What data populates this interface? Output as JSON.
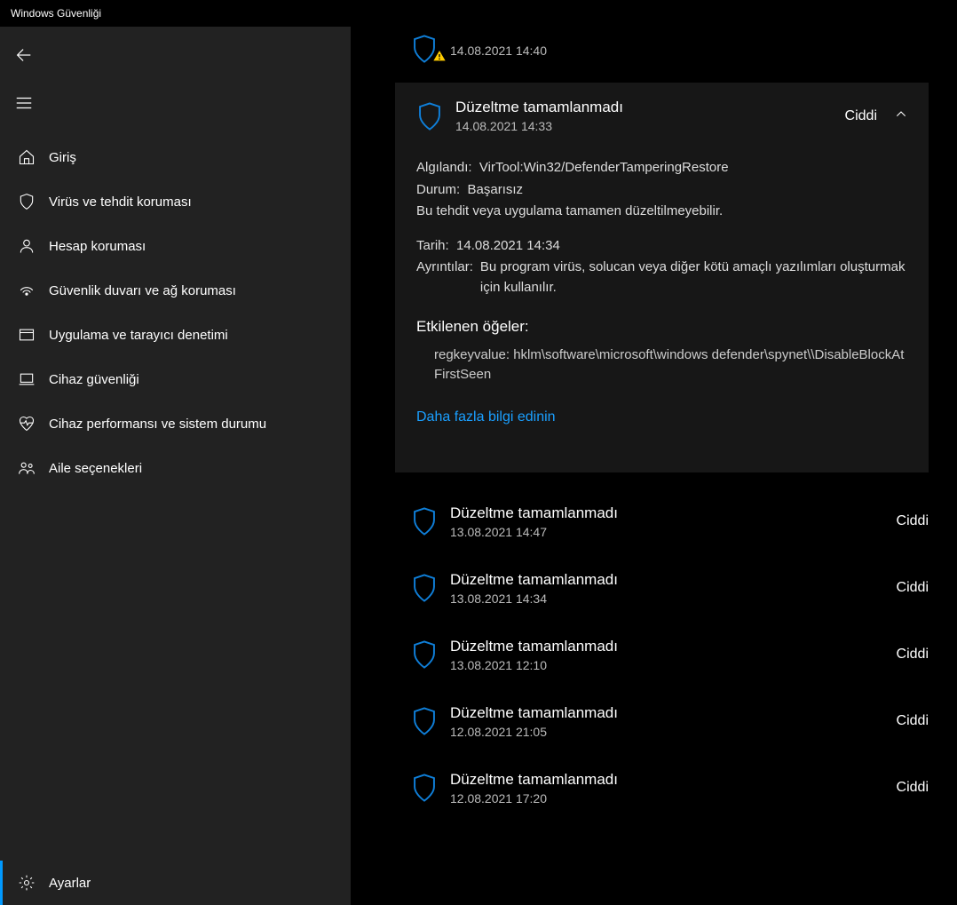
{
  "window": {
    "title": "Windows Güvenliği"
  },
  "sidebar": {
    "items": [
      {
        "label": "Giriş"
      },
      {
        "label": "Virüs ve tehdit koruması"
      },
      {
        "label": "Hesap koruması"
      },
      {
        "label": "Güvenlik duvarı ve ağ koruması"
      },
      {
        "label": "Uygulama ve tarayıcı denetimi"
      },
      {
        "label": "Cihaz güvenliği"
      },
      {
        "label": "Cihaz performansı ve sistem durumu"
      },
      {
        "label": "Aile seçenekleri"
      }
    ],
    "settings_label": "Ayarlar"
  },
  "top_partial": {
    "date": "14.08.2021 14:40"
  },
  "expanded": {
    "title": "Düzeltme tamamlanmadı",
    "date": "14.08.2021 14:33",
    "severity": "Ciddi",
    "detected_label": "Algılandı:",
    "detected_value": "VirTool:Win32/DefenderTamperingRestore",
    "status_label": "Durum:",
    "status_value": "Başarısız",
    "note": "Bu tehdit veya uygulama tamamen düzeltilmeyebilir.",
    "date2_label": "Tarih:",
    "date2_value": "14.08.2021 14:34",
    "details_label": "Ayrıntılar:",
    "details_value": "Bu program virüs, solucan veya diğer kötü amaçlı yazılımları oluşturmak için kullanılır.",
    "affected_title": "Etkilenen öğeler:",
    "affected_value": "regkeyvalue: hklm\\software\\microsoft\\windows defender\\spynet\\\\DisableBlockAtFirstSeen",
    "learn_more": "Daha fazla bilgi edinin"
  },
  "threats": [
    {
      "title": "Düzeltme tamamlanmadı",
      "date": "13.08.2021 14:47",
      "severity": "Ciddi"
    },
    {
      "title": "Düzeltme tamamlanmadı",
      "date": "13.08.2021 14:34",
      "severity": "Ciddi"
    },
    {
      "title": "Düzeltme tamamlanmadı",
      "date": "13.08.2021 12:10",
      "severity": "Ciddi"
    },
    {
      "title": "Düzeltme tamamlanmadı",
      "date": "12.08.2021 21:05",
      "severity": "Ciddi"
    },
    {
      "title": "Düzeltme tamamlanmadı",
      "date": "12.08.2021 17:20",
      "severity": "Ciddi"
    }
  ]
}
